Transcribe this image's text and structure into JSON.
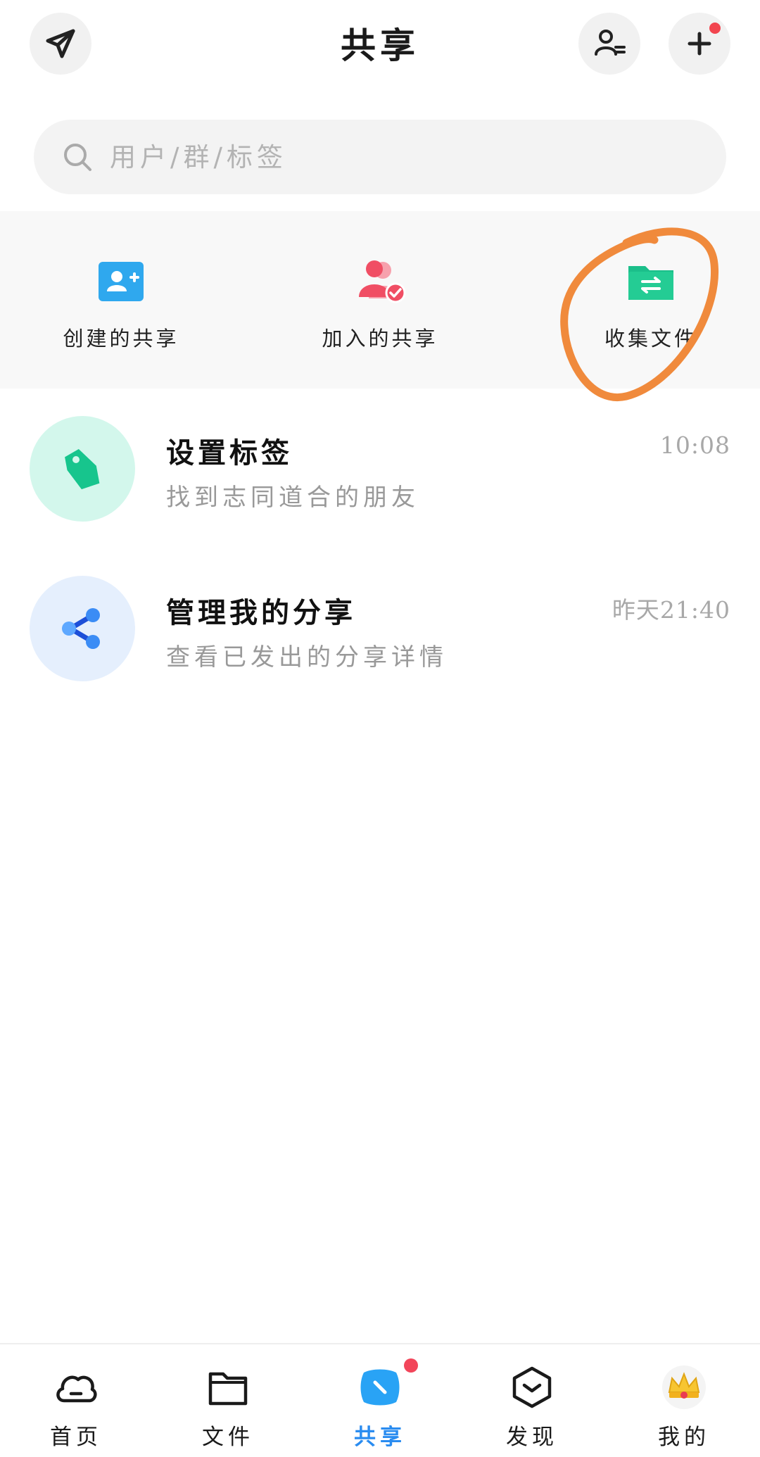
{
  "header": {
    "title": "共享"
  },
  "search": {
    "placeholder": "用户/群/标签"
  },
  "quick_actions": [
    {
      "label": "创建的共享",
      "icon": "add-user-icon"
    },
    {
      "label": "加入的共享",
      "icon": "joined-users-icon"
    },
    {
      "label": "收集文件",
      "icon": "folder-transfer-icon"
    }
  ],
  "list": [
    {
      "title": "设置标签",
      "subtitle": "找到志同道合的朋友",
      "time": "10:08",
      "icon": "tag-icon"
    },
    {
      "title": "管理我的分享",
      "subtitle": "查看已发出的分享详情",
      "time": "昨天21:40",
      "icon": "share-icon"
    }
  ],
  "nav": [
    {
      "label": "首页",
      "icon": "cloud-icon"
    },
    {
      "label": "文件",
      "icon": "folder-icon"
    },
    {
      "label": "共享",
      "icon": "share-tab-icon",
      "active": true
    },
    {
      "label": "发现",
      "icon": "discover-icon"
    },
    {
      "label": "我的",
      "icon": "crown-avatar-icon"
    }
  ],
  "colors": {
    "accent": "#2a8cf0",
    "badge": "#f2454f",
    "annotation": "#f08a3c"
  }
}
